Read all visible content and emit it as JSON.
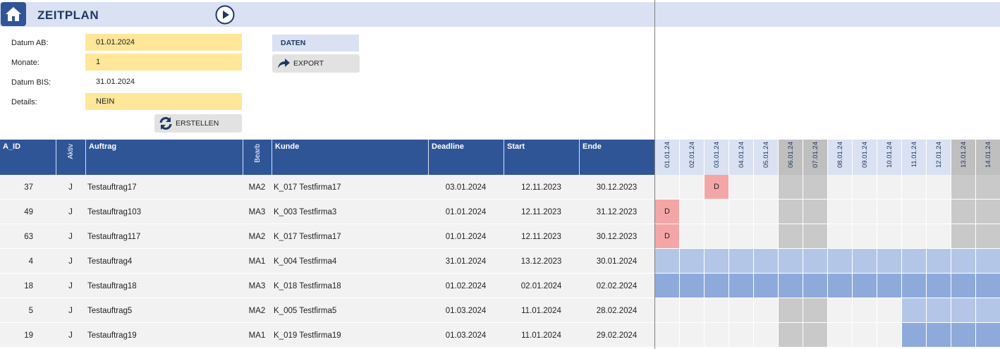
{
  "app": {
    "title": "ZEITPLAN"
  },
  "form": {
    "datum_ab_label": "Datum AB:",
    "datum_ab_value": "01.01.2024",
    "monate_label": "Monate:",
    "monate_value": "1",
    "datum_bis_label": "Datum BIS:",
    "datum_bis_value": "31.01.2024",
    "details_label": "Details:",
    "details_value": "NEIN"
  },
  "buttons": {
    "daten": "DATEN",
    "export": "EXPORT",
    "erstellen": "ERSTELLEN"
  },
  "table": {
    "headers": {
      "a_id": "A_ID",
      "aktiv": "Aktiv",
      "auftrag": "Auftrag",
      "bearb": "Bearb",
      "kunde": "Kunde",
      "deadline": "Deadline",
      "start": "Start",
      "ende": "Ende"
    },
    "rows": [
      {
        "a_id": "37",
        "aktiv": "J",
        "auftrag": "Testauftrag17",
        "bearb": "MA2",
        "kunde": "K_017 Testfirma17",
        "deadline": "03.01.2024",
        "start": "12.11.2023",
        "ende": "30.12.2023"
      },
      {
        "a_id": "49",
        "aktiv": "J",
        "auftrag": "Testauftrag103",
        "bearb": "MA3",
        "kunde": "K_003 Testfirma3",
        "deadline": "01.01.2024",
        "start": "12.11.2023",
        "ende": "31.12.2023"
      },
      {
        "a_id": "63",
        "aktiv": "J",
        "auftrag": "Testauftrag117",
        "bearb": "MA2",
        "kunde": "K_017 Testfirma17",
        "deadline": "01.01.2024",
        "start": "12.11.2023",
        "ende": "30.12.2023"
      },
      {
        "a_id": "4",
        "aktiv": "J",
        "auftrag": "Testauftrag4",
        "bearb": "MA1",
        "kunde": "K_004 Testfirma4",
        "deadline": "31.01.2024",
        "start": "13.12.2023",
        "ende": "30.01.2024"
      },
      {
        "a_id": "18",
        "aktiv": "J",
        "auftrag": "Testauftrag18",
        "bearb": "MA3",
        "kunde": "K_018 Testfirma18",
        "deadline": "01.02.2024",
        "start": "02.01.2024",
        "ende": "02.02.2024"
      },
      {
        "a_id": "5",
        "aktiv": "J",
        "auftrag": "Testauftrag5",
        "bearb": "MA2",
        "kunde": "K_005 Testfirma5",
        "deadline": "01.03.2024",
        "start": "11.01.2024",
        "ende": "28.02.2024"
      },
      {
        "a_id": "19",
        "aktiv": "J",
        "auftrag": "Testauftrag19",
        "bearb": "MA1",
        "kunde": "K_019 Testfirma19",
        "deadline": "01.03.2024",
        "start": "11.01.2024",
        "ende": "29.02.2024"
      }
    ]
  },
  "gantt": {
    "dates": [
      "01.01.24",
      "02.01.24",
      "03.01.24",
      "04.01.24",
      "05.01.24",
      "06.01.24",
      "07.01.24",
      "08.01.24",
      "09.01.24",
      "10.01.24",
      "11.01.24",
      "12.01.24",
      "13.01.24",
      "14.01.24"
    ],
    "weekend_indices": [
      5,
      6,
      12,
      13
    ],
    "deadline_marker": "D",
    "deadlines": [
      {
        "row": 0,
        "col": 2
      },
      {
        "row": 1,
        "col": 0
      },
      {
        "row": 2,
        "col": 0
      }
    ],
    "bars": [
      {
        "row": 3,
        "from": 0,
        "to": 13,
        "color": "#b4c6e7"
      },
      {
        "row": 4,
        "from": 0,
        "to": 13,
        "color": "#8eaadb"
      },
      {
        "row": 5,
        "from": 10,
        "to": 13,
        "color": "#b4c6e7"
      },
      {
        "row": 6,
        "from": 10,
        "to": 13,
        "color": "#8eaadb"
      }
    ],
    "colors": {
      "header_weekday": "#d9e1f2",
      "header_weekend": "#bfbfbf",
      "cell_weekday": "#f2f2f2",
      "cell_weekend": "#c9c9c9",
      "deadline": "#f4a6a6"
    }
  },
  "colors": {
    "accent": "#2f5597",
    "input_fill": "#ffe699",
    "header_band": "#d9e1f2"
  }
}
